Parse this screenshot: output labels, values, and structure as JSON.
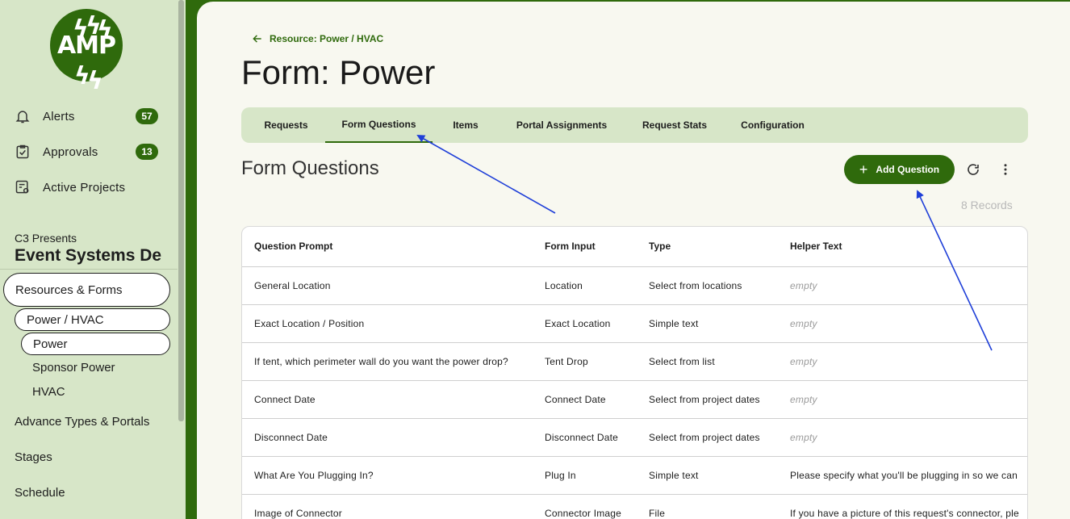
{
  "logo_text": "AMP",
  "colors": {
    "brand_green": "#2f6a0c",
    "sidebar_bg": "#d7e6c8",
    "annotation_arrow": "#1f3fd8"
  },
  "sidebar": {
    "nav": [
      {
        "label": "Alerts",
        "icon": "bell-icon",
        "badge": "57"
      },
      {
        "label": "Approvals",
        "icon": "clipboard-check-icon",
        "badge": "13"
      },
      {
        "label": "Active Projects",
        "icon": "project-eye-icon",
        "badge": ""
      }
    ],
    "org_label": "C3 Presents",
    "org_name": "Event Systems De",
    "resources_forms": "Resources & Forms",
    "power_hvac": "Power / HVAC",
    "power": "Power",
    "sponsor_power": "Sponsor Power",
    "hvac": "HVAC",
    "advance_types": "Advance Types & Portals",
    "stages": "Stages",
    "schedule": "Schedule"
  },
  "breadcrumb": "Resource: Power / HVAC",
  "page_title": "Form: Power",
  "tabs": [
    "Requests",
    "Form Questions",
    "Items",
    "Portal Assignments",
    "Request Stats",
    "Configuration"
  ],
  "active_tab": "Form Questions",
  "section_title": "Form Questions",
  "add_button": "Add Question",
  "records": "8 Records",
  "table": {
    "columns": [
      "Question Prompt",
      "Form Input",
      "Type",
      "Helper Text"
    ],
    "rows": [
      {
        "prompt": "General Location",
        "input": "Location",
        "type": "Select from locations",
        "helper": "empty"
      },
      {
        "prompt": "Exact Location / Position",
        "input": "Exact Location",
        "type": "Simple text",
        "helper": "empty"
      },
      {
        "prompt": "If tent, which perimeter wall do you want the power drop?",
        "input": "Tent Drop",
        "type": "Select from list",
        "helper": "empty"
      },
      {
        "prompt": "Connect Date",
        "input": "Connect Date",
        "type": "Select from project dates",
        "helper": "empty"
      },
      {
        "prompt": "Disconnect Date",
        "input": "Disconnect Date",
        "type": "Select from project dates",
        "helper": "empty"
      },
      {
        "prompt": "What Are You Plugging In?",
        "input": "Plug In",
        "type": "Simple text",
        "helper": "Please specify what you'll be plugging in so we can"
      },
      {
        "prompt": "Image of Connector",
        "input": "Connector Image",
        "type": "File",
        "helper": "If you have a picture of this request's connector, ple"
      }
    ]
  }
}
